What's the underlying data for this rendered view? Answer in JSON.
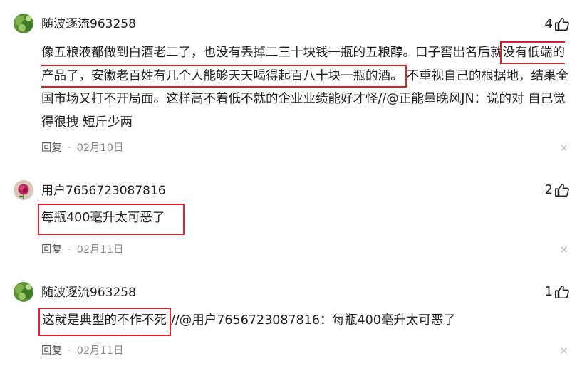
{
  "comments": [
    {
      "username": "随波逐流963258",
      "likes": "4",
      "avatar_icon": "green-leaf-avatar",
      "text_before": "像五粮液都做到白酒老二了，也没有丢掉二三十块钱一瓶的五粮醇。口子窖出名后就",
      "text_highlight": "没有低端的产品了，安徽老百姓有几个人能够天天喝得起百八十块一瓶的酒。",
      "text_after": "不重视自己的根据地，结果全国市场又打不开局面。这样高不着低不就的企业业绩能好才怪//@正能量晚风JN：说的对 自己觉得很拽 短斤少两",
      "reply_label": "回复",
      "date": "02月10日"
    },
    {
      "username": "用户7656723087816",
      "likes": "2",
      "avatar_icon": "rose-avatar",
      "text_highlight": "每瓶400毫升太可恶了",
      "reply_label": "回复",
      "date": "02月11日"
    },
    {
      "username": "随波逐流963258",
      "likes": "1",
      "avatar_icon": "green-leaf-avatar",
      "text_highlight": "这就是典型的不作不死",
      "text_after": "//@用户7656723087816：每瓶400毫升太可恶了",
      "reply_label": "回复",
      "date": "02月11日"
    }
  ],
  "colors": {
    "highlight_border": "#d8232a",
    "meta_text": "#8a8a8a"
  }
}
